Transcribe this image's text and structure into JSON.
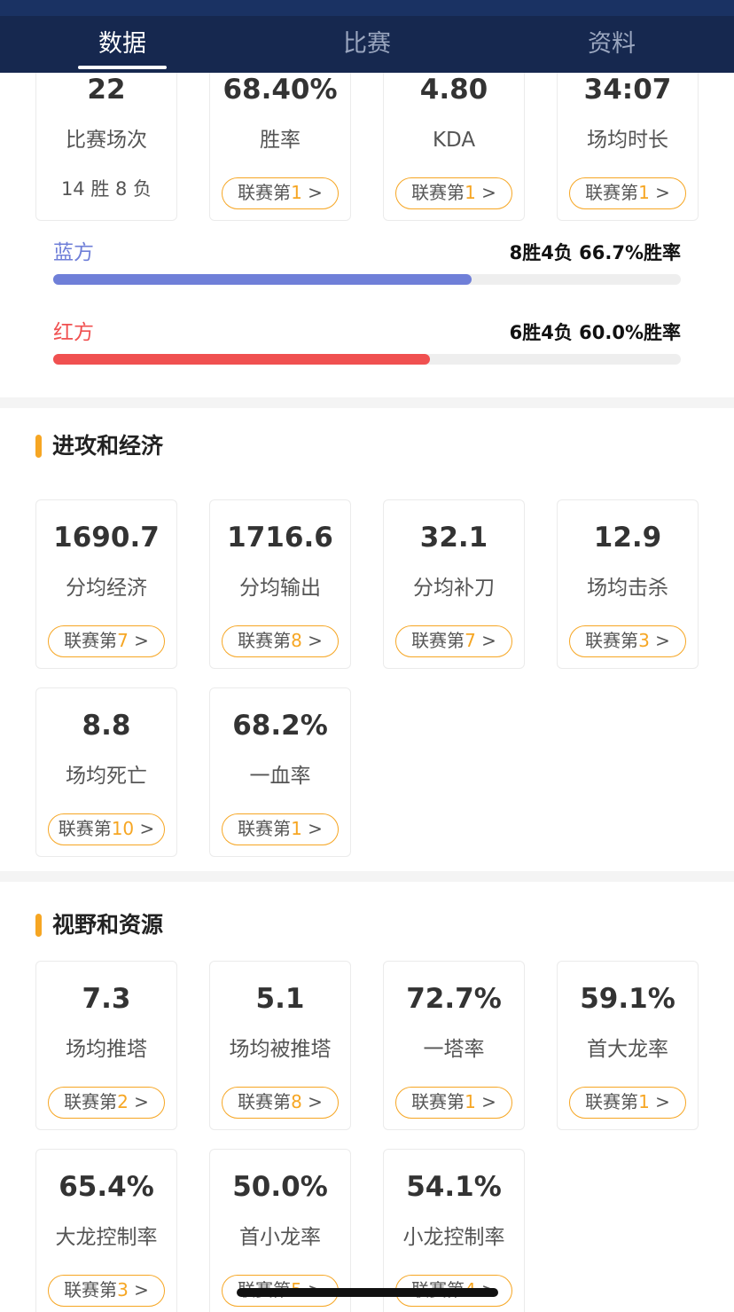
{
  "tabs": [
    {
      "label": "数据"
    },
    {
      "label": "比赛"
    },
    {
      "label": "资料"
    }
  ],
  "overview": {
    "cards": [
      {
        "value": "22",
        "label": "比赛场次",
        "sub": "14 胜 8 负"
      },
      {
        "value": "68.40%",
        "label": "胜率",
        "rank_prefix": "联赛第",
        "rank": "1",
        "rank_suffix": " >"
      },
      {
        "value": "4.80",
        "label": "KDA",
        "rank_prefix": "联赛第",
        "rank": "1",
        "rank_suffix": " >"
      },
      {
        "value": "34:07",
        "label": "场均时长",
        "rank_prefix": "联赛第",
        "rank": "1",
        "rank_suffix": " >"
      }
    ]
  },
  "sides": {
    "blue": {
      "label": "蓝方",
      "stat": "8胜4负 66.7%胜率",
      "rate": 0.667,
      "color": "#6f7fd8"
    },
    "red": {
      "label": "红方",
      "stat": "6胜4负 60.0%胜率",
      "rate": 0.6,
      "color": "#f05050"
    }
  },
  "attack": {
    "title": "进攻和经济",
    "cards": [
      {
        "value": "1690.7",
        "label": "分均经济",
        "rank_prefix": "联赛第",
        "rank": "7",
        "rank_suffix": " >"
      },
      {
        "value": "1716.6",
        "label": "分均输出",
        "rank_prefix": "联赛第",
        "rank": "8",
        "rank_suffix": " >"
      },
      {
        "value": "32.1",
        "label": "分均补刀",
        "rank_prefix": "联赛第",
        "rank": "7",
        "rank_suffix": " >"
      },
      {
        "value": "12.9",
        "label": "场均击杀",
        "rank_prefix": "联赛第",
        "rank": "3",
        "rank_suffix": " >"
      },
      {
        "value": "8.8",
        "label": "场均死亡",
        "rank_prefix": "联赛第",
        "rank": "10",
        "rank_suffix": " >"
      },
      {
        "value": "68.2%",
        "label": "一血率",
        "rank_prefix": "联赛第",
        "rank": "1",
        "rank_suffix": " >"
      }
    ]
  },
  "vision": {
    "title": "视野和资源",
    "cards": [
      {
        "value": "7.3",
        "label": "场均推塔",
        "rank_prefix": "联赛第",
        "rank": "2",
        "rank_suffix": " >"
      },
      {
        "value": "5.1",
        "label": "场均被推塔",
        "rank_prefix": "联赛第",
        "rank": "8",
        "rank_suffix": " >"
      },
      {
        "value": "72.7%",
        "label": "一塔率",
        "rank_prefix": "联赛第",
        "rank": "1",
        "rank_suffix": " >"
      },
      {
        "value": "59.1%",
        "label": "首大龙率",
        "rank_prefix": "联赛第",
        "rank": "1",
        "rank_suffix": " >"
      },
      {
        "value": "65.4%",
        "label": "大龙控制率",
        "rank_prefix": "联赛第",
        "rank": "3",
        "rank_suffix": " >"
      },
      {
        "value": "50.0%",
        "label": "首小龙率",
        "rank_prefix": "联赛第",
        "rank": "5",
        "rank_suffix": " >"
      },
      {
        "value": "54.1%",
        "label": "小龙控制率",
        "rank_prefix": "联赛第",
        "rank": "4",
        "rank_suffix": " >"
      }
    ]
  }
}
